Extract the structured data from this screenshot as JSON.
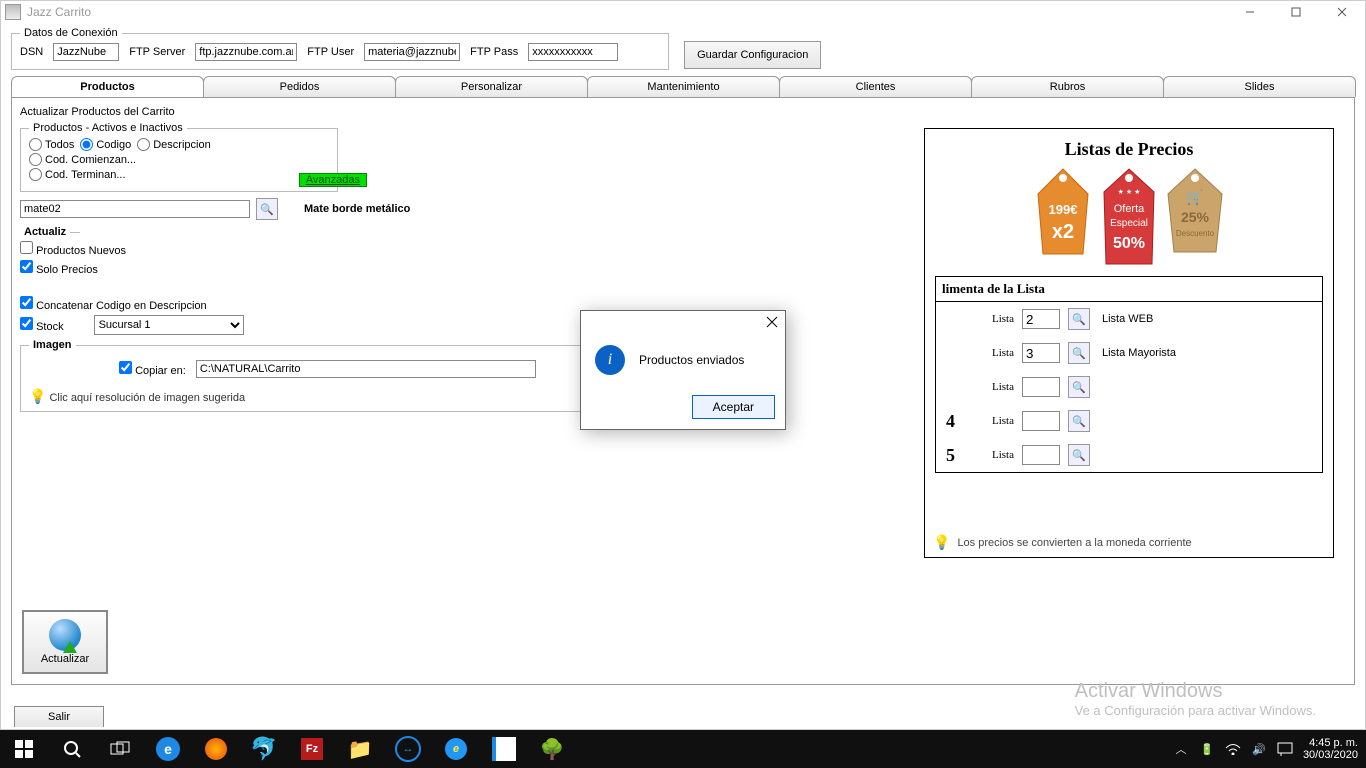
{
  "window": {
    "title": "Jazz Carrito"
  },
  "conn": {
    "legend": "Datos de Conexión",
    "dsn_label": "DSN",
    "dsn": "JazzNube",
    "ftpserver_label": "FTP Server",
    "ftpserver": "ftp.jazznube.com.ar",
    "ftpuser_label": "FTP User",
    "ftpuser": "materia@jazznube",
    "ftppass_label": "FTP Pass",
    "ftppass": "xxxxxxxxxxx",
    "save": "Guardar Configuracion"
  },
  "tabs": {
    "productos": "Productos",
    "pedidos": "Pedidos",
    "personalizar": "Personalizar",
    "mantenimiento": "Mantenimiento",
    "clientes": "Clientes",
    "rubros": "Rubros",
    "slides": "Slides"
  },
  "main": {
    "heading": "Actualizar Productos del Carrito",
    "filter": {
      "legend": "Productos - Activos e Inactivos",
      "todos": "Todos",
      "codigo": "Codigo",
      "descripcion": "Descripcion",
      "cod_comienzan": "Cod. Comienzan...",
      "cod_terminan": "Cod. Terminan...",
      "avanzadas": "Avanzadas"
    },
    "code_value": "mate02",
    "code_desc": "Mate borde metálico",
    "actualiz": {
      "legend": "Actualiz",
      "nuevos": "Productos Nuevos",
      "precios": "Solo Precios",
      "concat": "Concatenar Codigo en Descripcion",
      "stock": "Stock",
      "sucursal": "Sucursal 1"
    },
    "imagen": {
      "legend": "Imagen",
      "copiar": "Copiar en:",
      "path": "C:\\NATURAL\\Carrito",
      "reso": "Clic aquí resolución de imagen sugerida"
    },
    "actualizar_btn": "Actualizar"
  },
  "right": {
    "title": "Listas de Precios",
    "tag1_a": "199€",
    "tag1_b": "x2",
    "tag2_a": "Oferta",
    "tag2_b": "Especial",
    "tag2_c": "50%",
    "tag3_a": "25%",
    "tag3_b": "Descuento",
    "table_head": "limenta de la Lista",
    "lista": "Lista",
    "rows": [
      {
        "num": "",
        "val": "2",
        "name": "Lista WEB"
      },
      {
        "num": "",
        "val": "3",
        "name": "Lista Mayorista"
      },
      {
        "num": "",
        "val": "",
        "name": ""
      },
      {
        "num": "4",
        "val": "",
        "name": ""
      },
      {
        "num": "5",
        "val": "",
        "name": ""
      }
    ],
    "hint": "Los precios se convierten a la moneda corriente"
  },
  "modal": {
    "msg": "Productos enviados",
    "ok": "Aceptar"
  },
  "activate": {
    "h": "Activar Windows",
    "s": "Ve a Configuración para activar Windows."
  },
  "salir": "Salir",
  "clock": {
    "time": "4:45 p. m.",
    "date": "30/03/2020"
  }
}
